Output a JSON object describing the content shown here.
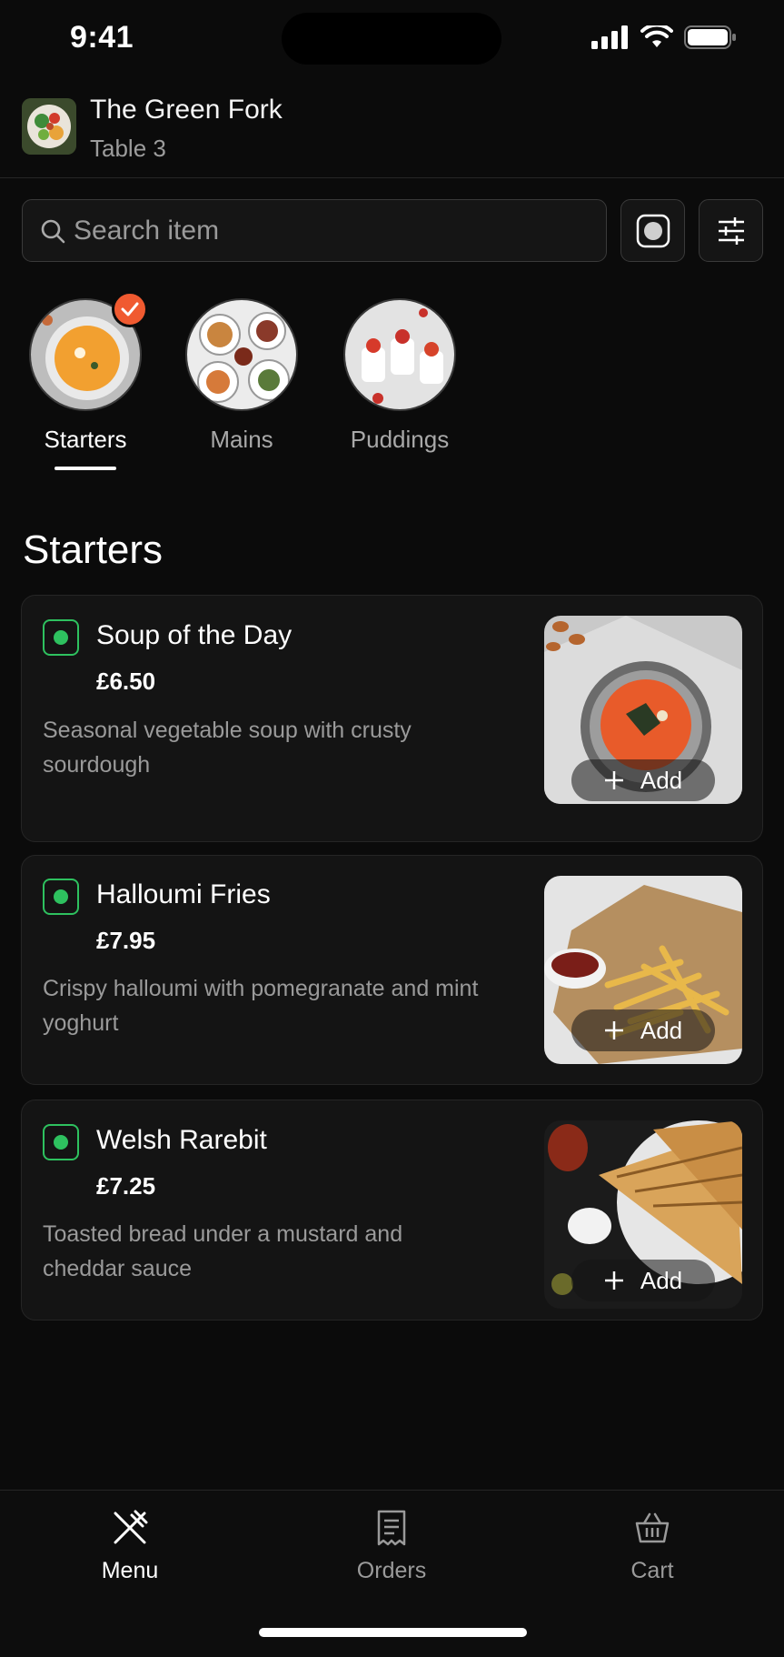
{
  "status_bar": {
    "time": "9:41"
  },
  "header": {
    "app_name": "The Green Fork",
    "table": "Table 3"
  },
  "search": {
    "placeholder": "Search item"
  },
  "icons": {
    "search": "search-icon",
    "veg_filter": "veg-toggle-icon",
    "filters": "sliders-icon",
    "check": "check-icon",
    "add": "plus-icon",
    "menu": "fork-knife-icon",
    "orders": "receipt-icon",
    "cart": "basket-icon"
  },
  "categories": [
    {
      "label": "Starters",
      "selected": true
    },
    {
      "label": "Mains",
      "selected": false
    },
    {
      "label": "Puddings",
      "selected": false
    }
  ],
  "section_title": "Starters",
  "items": [
    {
      "name": "Soup of the Day",
      "price": "£6.50",
      "description": "Seasonal vegetable soup with crusty sourdough",
      "add_label": "Add",
      "veg": true
    },
    {
      "name": "Halloumi Fries",
      "price": "£7.95",
      "description": "Crispy halloumi with pomegranate and mint yoghurt",
      "add_label": "Add",
      "veg": true
    },
    {
      "name": "Welsh Rarebit",
      "price": "£7.25",
      "description": "Toasted bread under a mustard and cheddar sauce",
      "add_label": "Add",
      "veg": true
    }
  ],
  "nav": [
    {
      "label": "Menu",
      "active": true
    },
    {
      "label": "Orders",
      "active": false
    },
    {
      "label": "Cart",
      "active": false
    }
  ],
  "colors": {
    "background": "#0b0b0b",
    "veg_green": "#2ec15f",
    "accent_orange": "#f05a30",
    "card": "#141414"
  }
}
